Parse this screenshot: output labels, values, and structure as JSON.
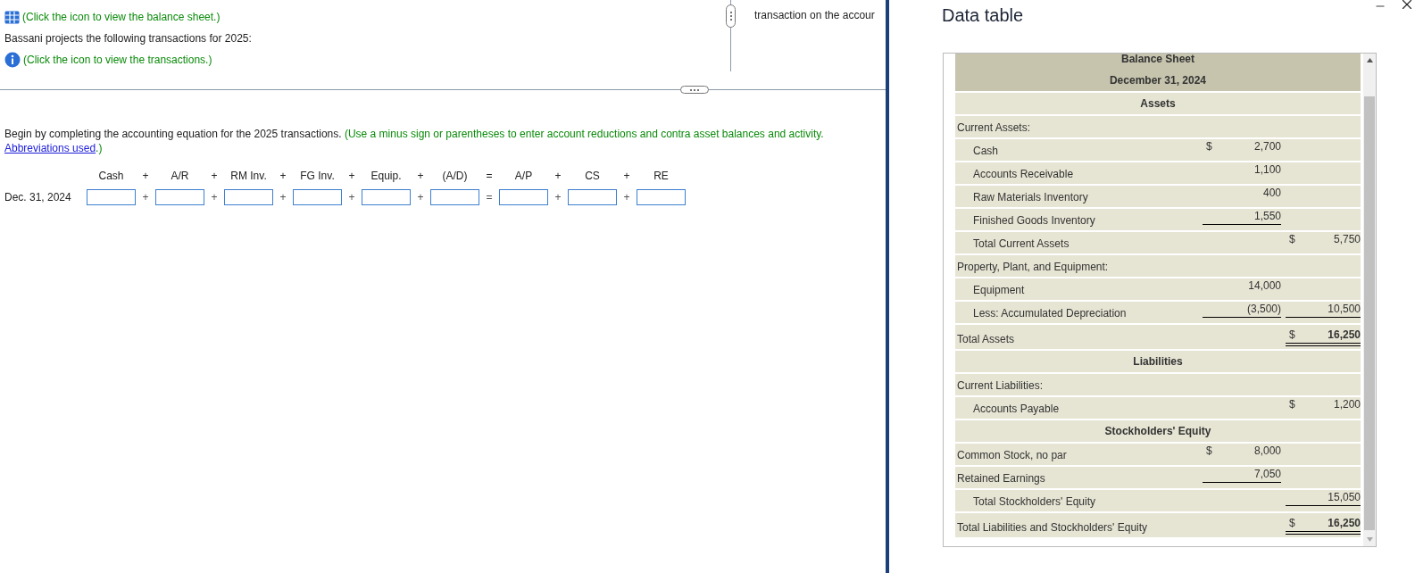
{
  "question": {
    "balance_sheet_link": "(Click the icon to view the balance sheet.)",
    "projection_text": "Bassani projects the following transactions for 2025:",
    "transactions_link": "(Click the icon to view the transactions.)",
    "side_text": "transaction on the accour",
    "instruction": "Begin by completing the accounting equation for the 2025 transactions.",
    "note": "(Use a minus sign or parentheses to enter account reductions and contra asset balances and activity.",
    "abbreviations_link": "Abbreviations used",
    "note_end": ".)"
  },
  "equation": {
    "columns": [
      {
        "header": "Cash",
        "header_operator": "+",
        "cell_operator": "+"
      },
      {
        "header": "A/R",
        "header_operator": "+",
        "cell_operator": "+"
      },
      {
        "header": "RM Inv.",
        "header_operator": "+",
        "cell_operator": "+"
      },
      {
        "header": "FG Inv.",
        "header_operator": "+",
        "cell_operator": "+"
      },
      {
        "header": "Equip.",
        "header_operator": "+",
        "cell_operator": "+"
      },
      {
        "header": "(A/D)",
        "header_operator": "=",
        "cell_operator": "="
      },
      {
        "header": "A/P",
        "header_operator": "+",
        "cell_operator": "+"
      },
      {
        "header": "CS",
        "header_operator": "+",
        "cell_operator": "+"
      },
      {
        "header": "RE"
      }
    ],
    "rows": [
      {
        "label": "Dec. 31, 2024"
      }
    ]
  },
  "dialog": {
    "title": "Data table",
    "rows": [
      {
        "kind": "title",
        "label": "Balance Sheet"
      },
      {
        "kind": "title",
        "label": "December 31, 2024"
      },
      {
        "kind": "heading",
        "label": "Assets"
      },
      {
        "kind": "section",
        "label": "Current Assets:"
      },
      {
        "kind": "item",
        "label": "Cash",
        "col1": {
          "dollar": "$",
          "value": "2,700"
        }
      },
      {
        "kind": "item",
        "label": "Accounts Receivable",
        "col1": {
          "value": "1,100"
        }
      },
      {
        "kind": "item",
        "label": "Raw Materials Inventory",
        "col1": {
          "value": "400"
        }
      },
      {
        "kind": "item",
        "label": "Finished Goods Inventory",
        "col1": {
          "value": "1,550",
          "underline": true
        }
      },
      {
        "kind": "item",
        "label": "Total Current Assets",
        "col2": {
          "dollar": "$",
          "value": "5,750"
        }
      },
      {
        "kind": "section",
        "label": "Property, Plant, and Equipment:"
      },
      {
        "kind": "item",
        "label": "Equipment",
        "col1": {
          "value": "14,000"
        }
      },
      {
        "kind": "item",
        "label": "Less: Accumulated Depreciation",
        "col1": {
          "value": "(3,500)",
          "underline": true
        },
        "col2": {
          "value": "10,500",
          "underline": true
        }
      },
      {
        "kind": "section",
        "label": "Total Assets",
        "col2": {
          "dollar": "$",
          "value": "16,250",
          "double_underline": true,
          "bold": true
        }
      },
      {
        "kind": "heading",
        "label": "Liabilities"
      },
      {
        "kind": "section",
        "label": "Current Liabilities:"
      },
      {
        "kind": "item",
        "label": "Accounts Payable",
        "col2": {
          "dollar": "$",
          "value": "1,200"
        }
      },
      {
        "kind": "heading",
        "label": "Stockholders' Equity"
      },
      {
        "kind": "section",
        "label": "Common Stock, no par",
        "col1": {
          "dollar": "$",
          "value": "8,000"
        }
      },
      {
        "kind": "section",
        "label": "Retained Earnings",
        "col1": {
          "value": "7,050",
          "underline": true
        }
      },
      {
        "kind": "item",
        "label": "Total Stockholders' Equity",
        "col2": {
          "value": "15,050",
          "underline": true
        }
      },
      {
        "kind": "section",
        "label": "Total Liabilities and Stockholders' Equity",
        "col2": {
          "dollar": "$",
          "value": "16,250",
          "double_underline": true,
          "bold": true
        }
      }
    ]
  }
}
